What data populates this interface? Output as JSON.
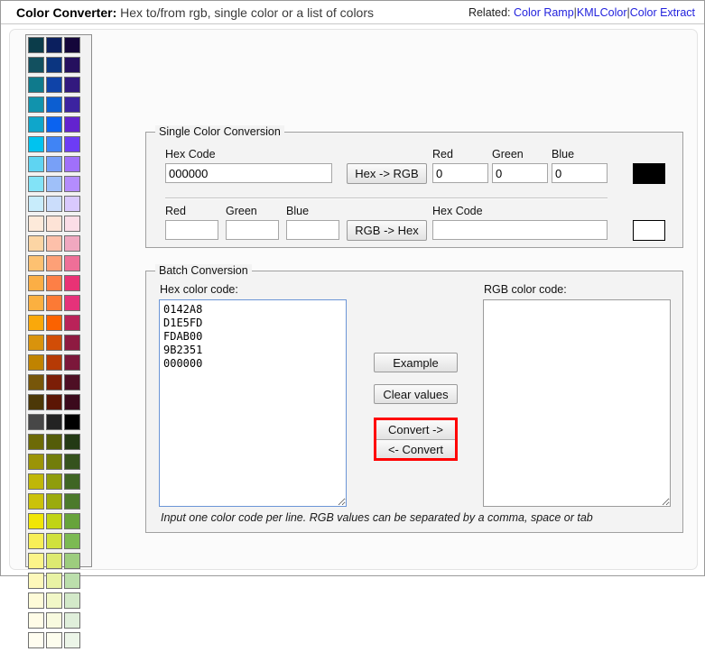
{
  "header": {
    "title_bold": "Color Converter:",
    "title_rest": "Hex to/from rgb, single color or a list of colors",
    "related_label": "Related:",
    "related_links": [
      "Color Ramp",
      "KMLColor",
      "Color Extract"
    ],
    "separator": "|"
  },
  "palette": {
    "rows": [
      [
        "#0b3c4a",
        "#0b1f5e",
        "#14063a"
      ],
      [
        "#12505f",
        "#0b3580",
        "#25105e"
      ],
      [
        "#0f7a8c",
        "#0f43a8",
        "#32197e"
      ],
      [
        "#1193ad",
        "#0c5ed1",
        "#3c23a0"
      ],
      [
        "#0fa6cb",
        "#0b63f0",
        "#6323cf"
      ],
      [
        "#00c3ef",
        "#4084f5",
        "#6d3cf5"
      ],
      [
        "#5fd4f2",
        "#78a0f7",
        "#a070fb"
      ],
      [
        "#82e3f7",
        "#9fc0f9",
        "#b48cfd"
      ],
      [
        "#c8ecfb",
        "#cbddfb",
        "#d9c9fd"
      ],
      [
        "#fdeada",
        "#fde3d6",
        "#fbdde7"
      ],
      [
        "#fcd5a4",
        "#fdc0aa",
        "#f0a8c0"
      ],
      [
        "#fdc171",
        "#fda077",
        "#ef6f98"
      ],
      [
        "#fbae45",
        "#fd7f46",
        "#e93275"
      ],
      [
        "#fbb040",
        "#fc7a35",
        "#e5327a"
      ],
      [
        "#faa80a",
        "#fb6200",
        "#b92359"
      ],
      [
        "#d9930c",
        "#d14d07",
        "#8e1a41"
      ],
      [
        "#c08300",
        "#b63a05",
        "#7b173a"
      ],
      [
        "#77560a",
        "#7c1e07",
        "#4e0f24"
      ],
      [
        "#4c3807",
        "#5b1504",
        "#3b0a1c"
      ],
      [
        "#474747",
        "#232323",
        "#000000"
      ],
      [
        "#6d6a07",
        "#545c0a",
        "#233915"
      ],
      [
        "#9b9407",
        "#727d0b",
        "#35521d"
      ],
      [
        "#c0b708",
        "#8f9d0d",
        "#3f6524"
      ],
      [
        "#cbc20a",
        "#9bab0d",
        "#4c7a2c"
      ],
      [
        "#f1e606",
        "#c0d415",
        "#67a33b"
      ],
      [
        "#f7ef57",
        "#d0e13d",
        "#7cba53"
      ],
      [
        "#fbf489",
        "#ddea71",
        "#9dcd7e"
      ],
      [
        "#fdf8ba",
        "#e8f2a4",
        "#bcdfac"
      ],
      [
        "#fefbd8",
        "#f1f7c7",
        "#d3e9c9"
      ],
      [
        "#fffce7",
        "#f8fadf",
        "#e0efdb"
      ],
      [
        "#fffdf0",
        "#fdfdee",
        "#ecf5e8"
      ]
    ]
  },
  "single": {
    "legend": "Single Color Conversion",
    "hex_label": "Hex Code",
    "hex_value": "000000",
    "hex_to_rgb_button": "Hex -> RGB",
    "red_label": "Red",
    "green_label": "Green",
    "blue_label": "Blue",
    "red_value": "0",
    "green_value": "0",
    "blue_value": "0",
    "preview_color_top": "#000000",
    "red_label2": "Red",
    "green_label2": "Green",
    "blue_label2": "Blue",
    "red_value2": "",
    "green_value2": "",
    "blue_value2": "",
    "rgb_to_hex_button": "RGB -> Hex",
    "hex_label2": "Hex Code",
    "hex_value2": "",
    "preview_color_bottom": "#ffffff"
  },
  "batch": {
    "legend": "Batch Conversion",
    "hex_area_label": "Hex color code:",
    "hex_area_value": "0142A8\nD1E5FD\nFDAB00\n9B2351\n000000",
    "rgb_area_label": "RGB color code:",
    "rgb_area_value": "",
    "example_button": "Example",
    "clear_button": "Clear values",
    "convert_right_button": "Convert ->",
    "convert_left_button": "<- Convert",
    "hint": "Input one color code per line. RGB values can be separated by a comma, space or tab",
    "highlight_color": "#ff0000"
  }
}
